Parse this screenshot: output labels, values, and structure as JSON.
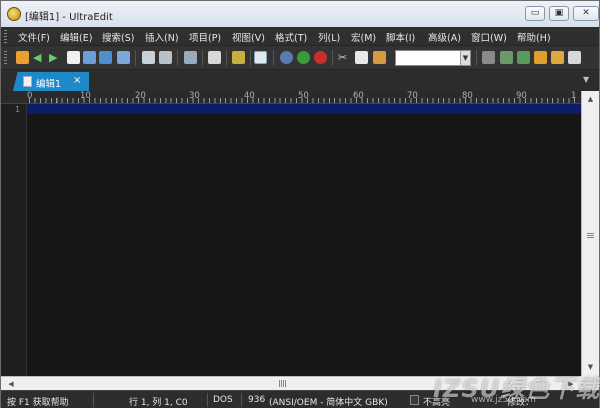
{
  "window": {
    "title": "[编辑1] - UltraEdit",
    "minimize_symbol": "▭",
    "maximize_symbol": "▣",
    "close_symbol": "✕"
  },
  "menu": {
    "items": [
      "文件(F)",
      "编辑(E)",
      "搜索(S)",
      "插入(N)",
      "项目(P)",
      "视图(V)",
      "格式(T)",
      "列(L)",
      "宏(M)",
      "脚本(I)",
      "高级(A)",
      "窗口(W)",
      "帮助(H)"
    ]
  },
  "toolbar": {
    "icons": [
      "new-file-icon",
      "back-arrow-icon",
      "forward-arrow-icon",
      "file-icon",
      "open-folder-icon",
      "folder-icon",
      "save-icon",
      "print-icon",
      "print-preview-icon",
      "properties-icon",
      "document-icon",
      "column-icon",
      "list-icon",
      "globe-icon",
      "add-icon",
      "remove-icon",
      "cut-icon",
      "copy-icon",
      "paste-icon",
      "binoculars-icon",
      "replace-icon",
      "find-next-icon",
      "bookmark-icon",
      "panel-icon",
      "settings-icon"
    ],
    "combo_value": "",
    "accent_color": "#1e88c8"
  },
  "tabs": [
    {
      "label": "编辑1",
      "close": "×"
    }
  ],
  "ruler": {
    "labels": [
      "0",
      "10",
      "20",
      "30",
      "40",
      "50",
      "60",
      "70",
      "80",
      "90",
      "1"
    ]
  },
  "editor": {
    "line_numbers": [
      "1"
    ],
    "current_line_color": "#0c1e6a",
    "background_color": "#161616"
  },
  "scrollbars": {
    "up": "▲",
    "down": "▼",
    "left": "◀",
    "right": "▶",
    "grip": "|||"
  },
  "status": {
    "help": "按 F1 获取帮助",
    "position": "行 1, 列 1, C0",
    "line_ending": "DOS",
    "codepage": "936",
    "encoding": "(ANSI/OEM - 简体中文 GBK)",
    "highlight": "不高亮",
    "modified": "修改："
  },
  "watermark": {
    "text": "IZSU绿色下载",
    "url": "www.jz5u.com"
  }
}
